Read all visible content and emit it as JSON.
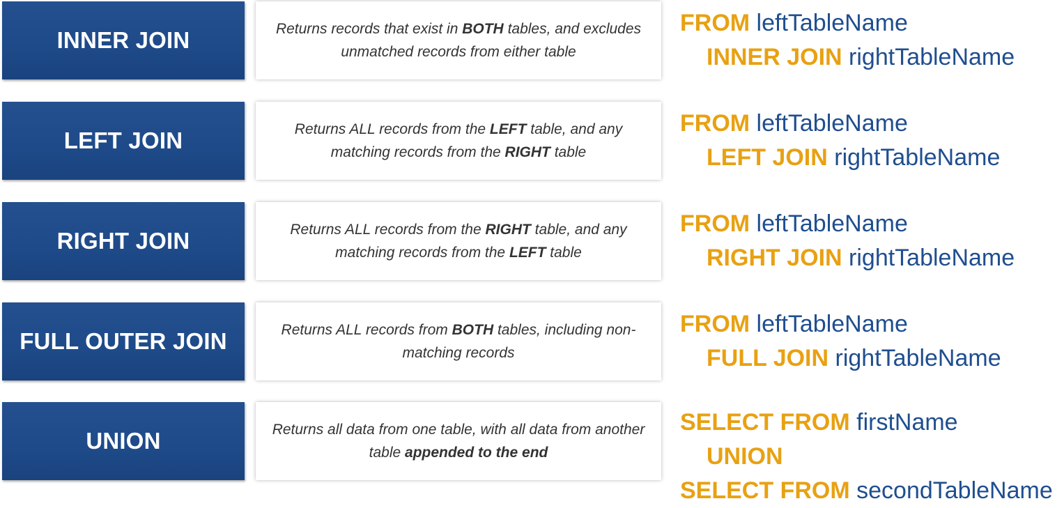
{
  "rows": [
    {
      "label": "INNER JOIN",
      "desc": {
        "pre": "Returns records that exist in ",
        "bold": "BOTH",
        "mid": " tables, and excludes unmatched records from either table",
        "bold2": "",
        "post": ""
      },
      "code": [
        {
          "kw": "FROM",
          "id": "leftTableName"
        },
        {
          "kw": "INNER JOIN",
          "id": "rightTableName"
        }
      ]
    },
    {
      "label": "LEFT JOIN",
      "desc": {
        "pre": "Returns ALL records from the ",
        "bold": "LEFT",
        "mid": " table, and any matching records from the ",
        "bold2": "RIGHT",
        "post": " table"
      },
      "code": [
        {
          "kw": "FROM",
          "id": "leftTableName"
        },
        {
          "kw": "LEFT JOIN",
          "id": "rightTableName"
        }
      ]
    },
    {
      "label": "RIGHT JOIN",
      "desc": {
        "pre": "Returns ALL records from the ",
        "bold": "RIGHT",
        "mid": " table, and any matching records from the ",
        "bold2": "LEFT",
        "post": " table"
      },
      "code": [
        {
          "kw": "FROM",
          "id": "leftTableName"
        },
        {
          "kw": "RIGHT JOIN",
          "id": "rightTableName"
        }
      ]
    },
    {
      "label": "FULL OUTER JOIN",
      "desc": {
        "pre": "Returns ALL records from ",
        "bold": "BOTH",
        "mid": " tables, including non-matching records",
        "bold2": "",
        "post": ""
      },
      "code": [
        {
          "kw": "FROM",
          "id": "leftTableName"
        },
        {
          "kw": "FULL JOIN",
          "id": "rightTableName"
        }
      ]
    },
    {
      "label": "UNION",
      "desc": {
        "pre": "Returns all data from one table, with all data from another table ",
        "bold": "appended to the end",
        "mid": "",
        "bold2": "",
        "post": ""
      },
      "code": [
        {
          "kw": "SELECT FROM",
          "id": "firstName"
        },
        {
          "kw": "UNION",
          "id": ""
        },
        {
          "kw": "SELECT FROM",
          "id": "secondTableName"
        }
      ]
    }
  ],
  "colors": {
    "label_bg": "#1e4a89",
    "keyword": "#e8a112",
    "identifier": "#1f4e8f"
  }
}
